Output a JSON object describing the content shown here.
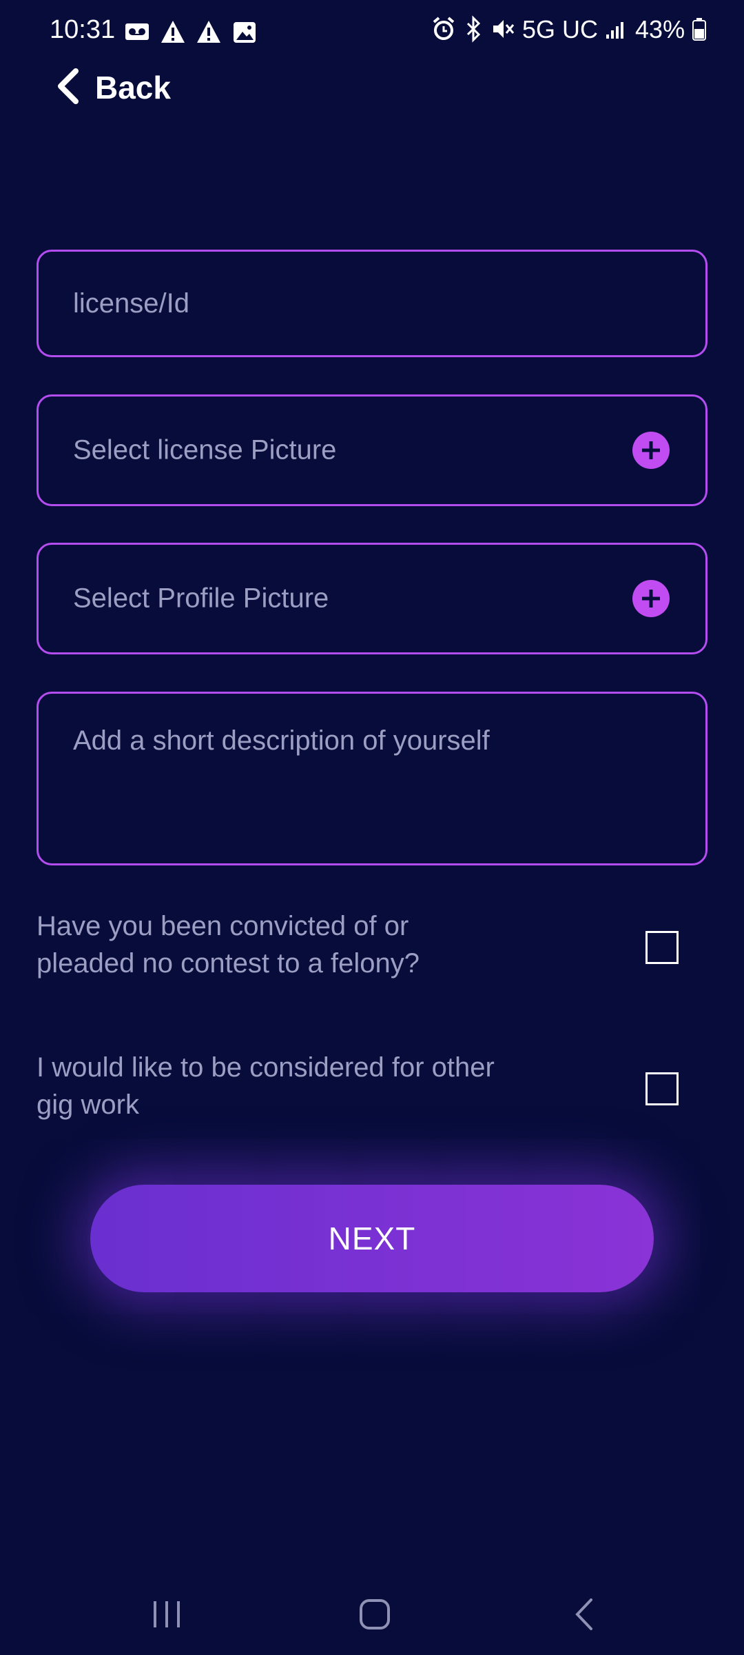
{
  "status_bar": {
    "time": "10:31",
    "network": "5G UC",
    "battery": "43%",
    "left_icons": [
      "voicemail-icon",
      "alert-icon",
      "alert-icon",
      "image-icon"
    ],
    "right_icons": [
      "alarm-icon",
      "bluetooth-icon",
      "mute-icon",
      "signal-icon",
      "battery-icon"
    ]
  },
  "header": {
    "back_label": "Back"
  },
  "form": {
    "license_id_placeholder": "license/Id",
    "license_picture_label": "Select license Picture",
    "profile_picture_label": "Select Profile Picture",
    "description_placeholder": "Add a short description of yourself",
    "questions": [
      {
        "text": "Have you been convicted of or pleaded no contest to a felony?",
        "checked": false
      },
      {
        "text": "I would like to be considered for other gig work",
        "checked": false
      }
    ],
    "next_label": "NEXT"
  },
  "colors": {
    "background": "#070c3a",
    "accent": "#c14cf2",
    "button_gradient_start": "#6a2fd0",
    "button_gradient_end": "#8a33d6",
    "placeholder": "#9c9fc3"
  }
}
